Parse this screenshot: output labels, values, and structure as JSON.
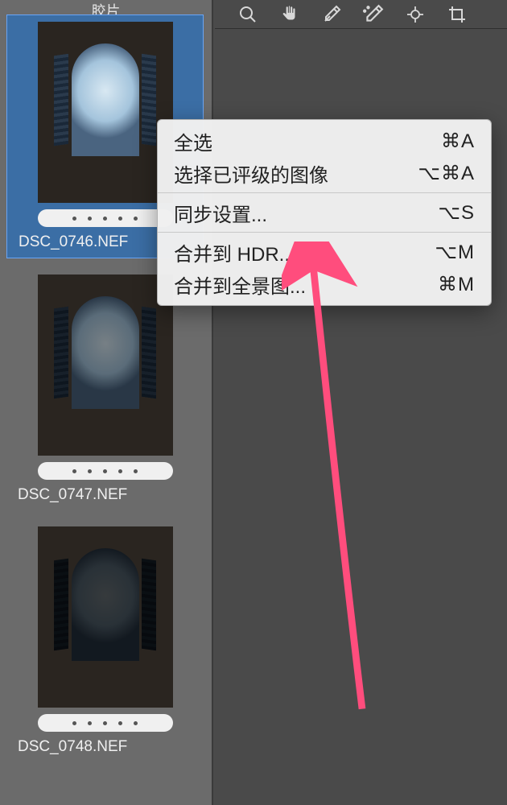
{
  "sidebar": {
    "header_label": "胶片",
    "thumbnails": [
      {
        "filename": "DSC_0746.NEF",
        "selected": true
      },
      {
        "filename": "DSC_0747.NEF",
        "selected": false
      },
      {
        "filename": "DSC_0748.NEF",
        "selected": false
      }
    ]
  },
  "toolbar": {
    "tools": [
      {
        "name": "zoom-icon"
      },
      {
        "name": "hand-icon"
      },
      {
        "name": "eyedropper-icon"
      },
      {
        "name": "eyedropper-adjust-icon"
      },
      {
        "name": "target-icon"
      },
      {
        "name": "crop-icon"
      }
    ]
  },
  "context_menu": {
    "items": [
      {
        "label": "全选",
        "shortcut": "⌘A"
      },
      {
        "label": "选择已评级的图像",
        "shortcut": "⌥⌘A"
      },
      {
        "separator": true
      },
      {
        "label": "同步设置...",
        "shortcut": "⌥S"
      },
      {
        "separator": true
      },
      {
        "label": "合并到 HDR...",
        "shortcut": "⌥M"
      },
      {
        "label": "合并到全景图...",
        "shortcut": "⌘M"
      }
    ]
  },
  "annotation": {
    "arrow_color": "#ff4d7d",
    "target": "合并到 HDR..."
  }
}
